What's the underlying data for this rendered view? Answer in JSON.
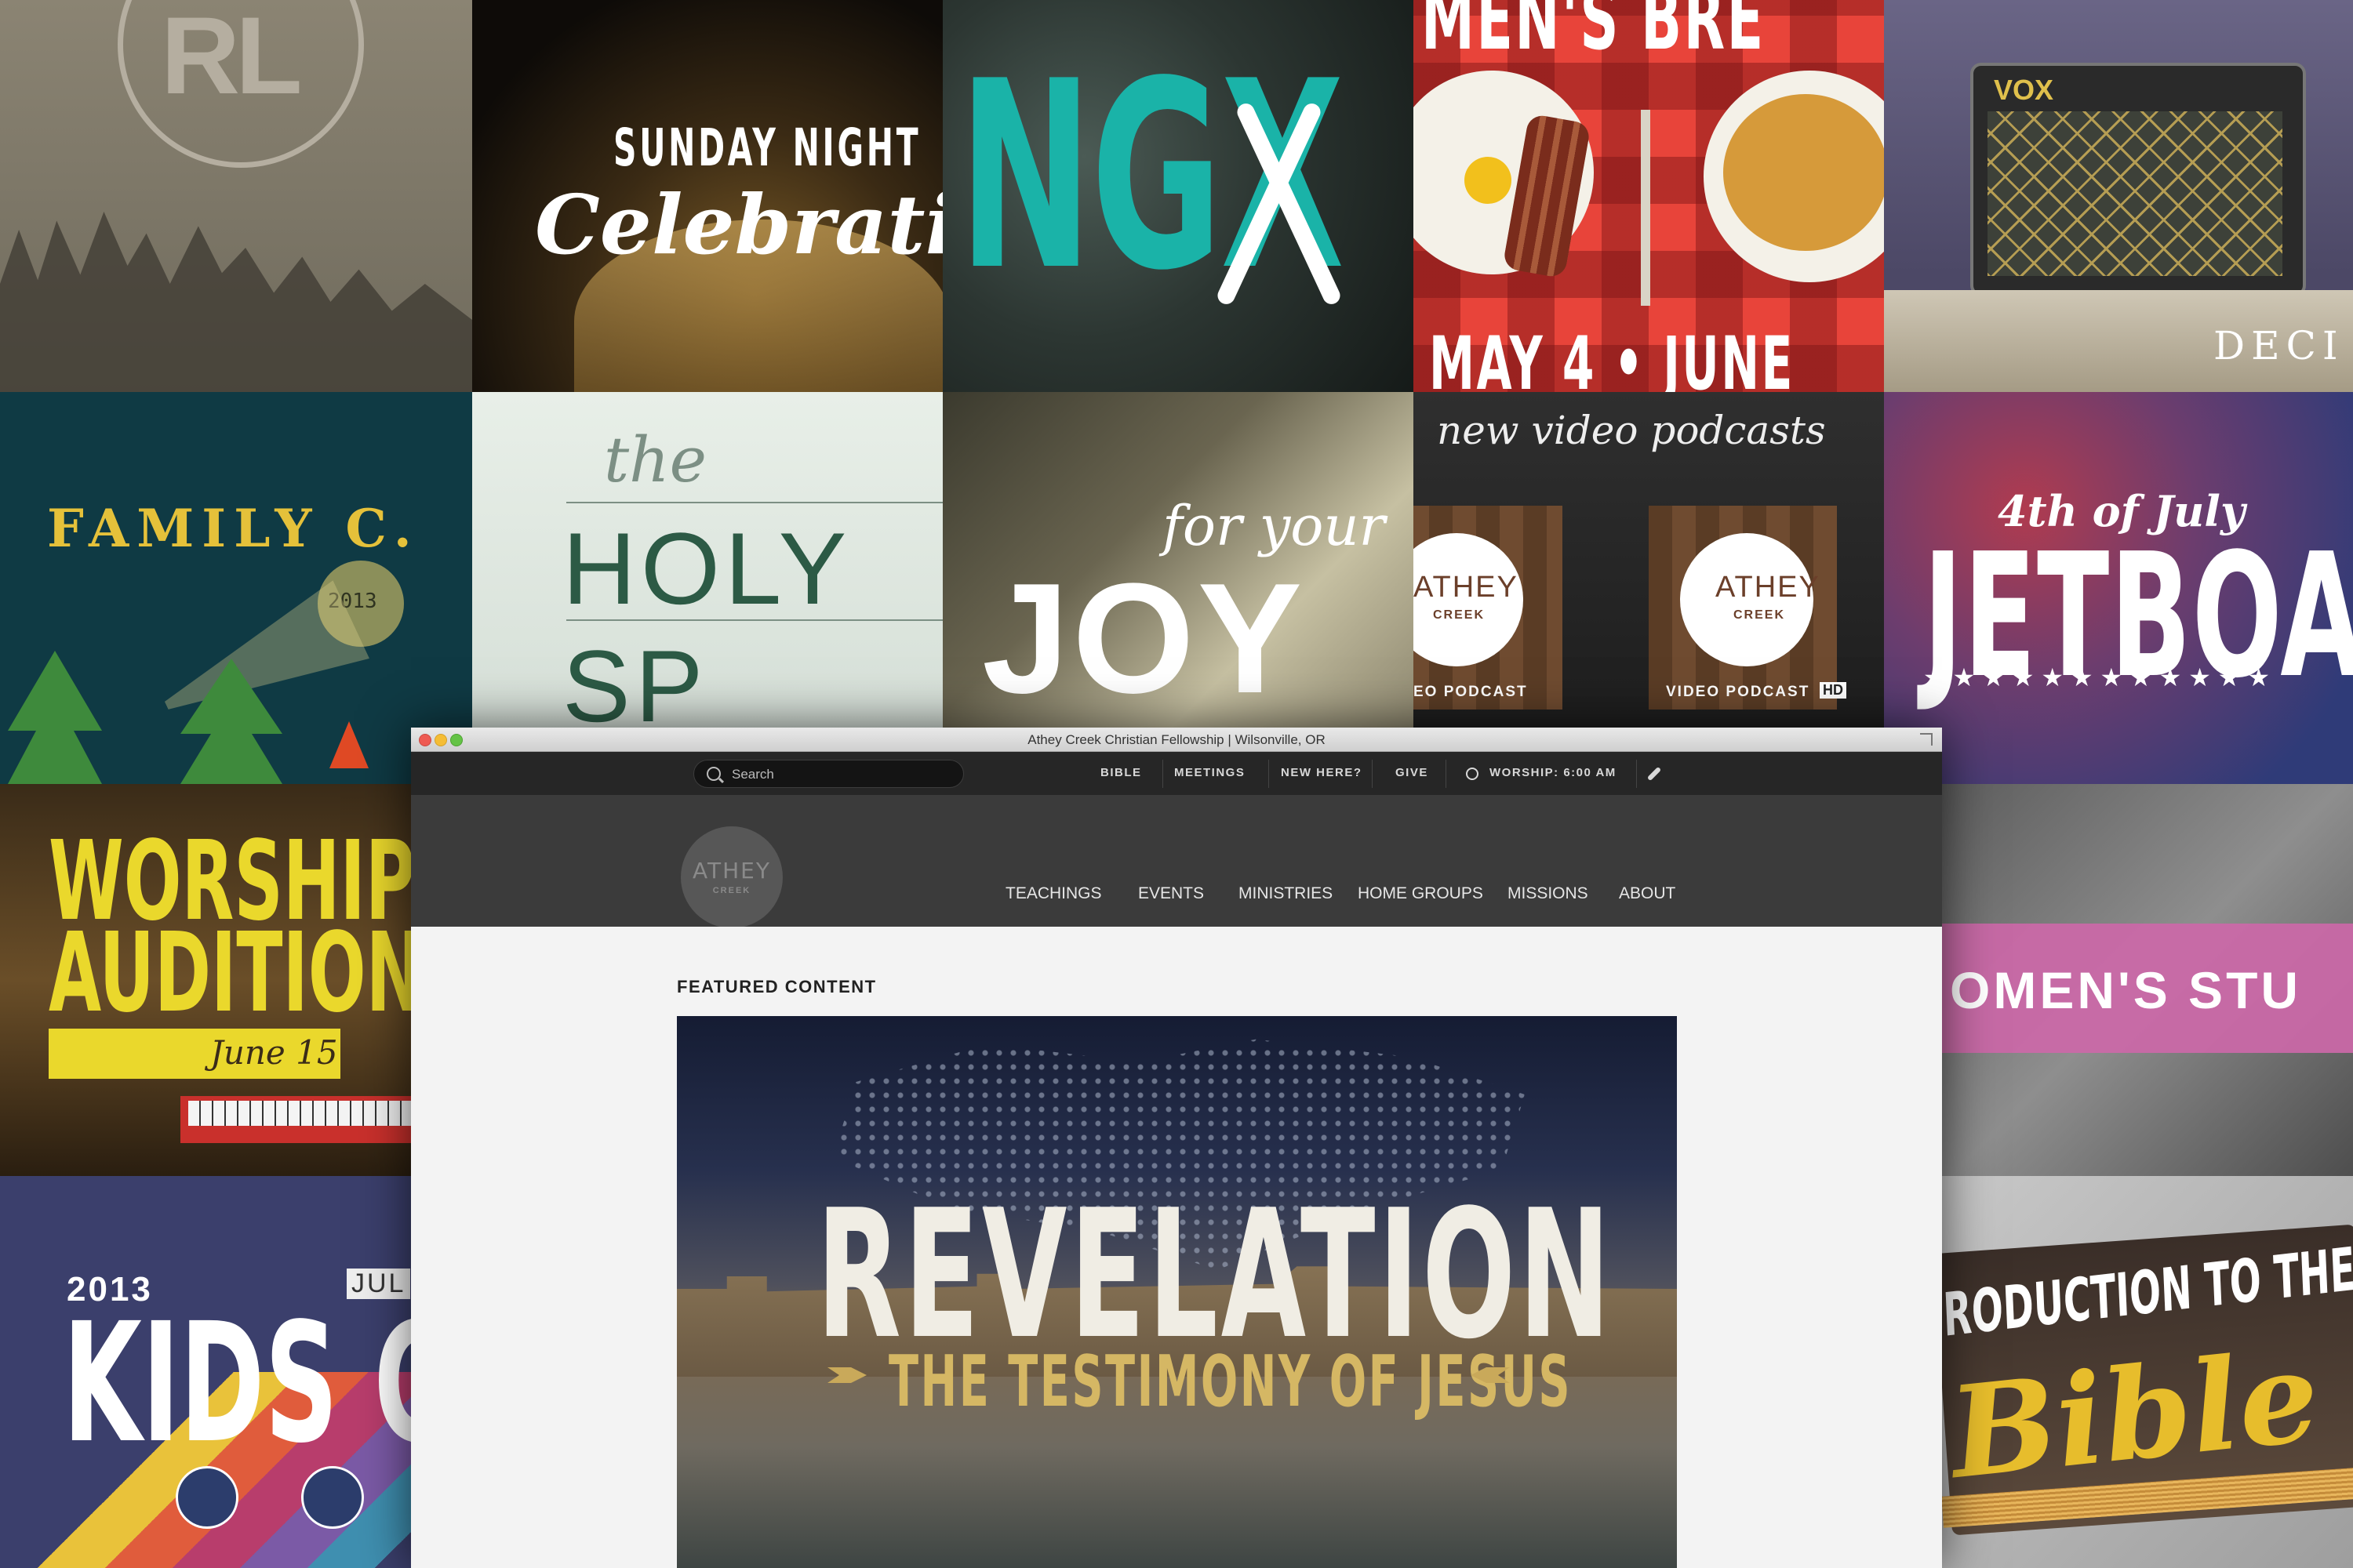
{
  "tiles": {
    "rl": "RL",
    "sunday_top": "SUNDAY NIGHT",
    "sunday_script": "Celebratio",
    "ngx": "NGX",
    "mens": "MEN'S BRE",
    "mens_date": "MAY 4 • JUNE",
    "vox": "VOX",
    "vox_dec": "DECI",
    "family": "FAMILY C.",
    "family_year": "2013",
    "holy_the": "the",
    "holy": "HOLY SP",
    "joy_script": "for your",
    "joy": "JOY",
    "podcast_title": "new video podcasts",
    "podcast_brand": "ATHEY",
    "podcast_sub": "CREEK",
    "podcast_label_left": "EO PODCAST",
    "podcast_label_right": "VIDEO PODCAST",
    "podcast_hd": "HD",
    "july_top": "4th of July",
    "july": "JETBOATS",
    "stars": "★ ★ ★ ★ ★ ★ ★ ★ ★ ★ ★ ★",
    "worship1": "WORSHIP",
    "worship2": "AUDITIONS",
    "worship_date": "June 15",
    "women": "OMEN'S STU",
    "kids_year": "2013",
    "kids_month": "JUL",
    "kids": "KIDS CA",
    "intro": "RODUCTION TO THE",
    "bible": "Bible"
  },
  "browser": {
    "title": "Athey Creek Christian Fellowship | Wilsonville, OR",
    "search_placeholder": "Search",
    "top_links": [
      "BIBLE",
      "MEETINGS",
      "NEW HERE?",
      "GIVE"
    ],
    "worship": "WORSHIP: 6:00 AM",
    "logo_name": "ATHEY",
    "logo_sub": "CREEK",
    "main_nav": [
      "TEACHINGS",
      "EVENTS",
      "MINISTRIES",
      "HOME GROUPS",
      "MISSIONS",
      "ABOUT"
    ],
    "featured_heading": "FEATURED CONTENT",
    "hero_title": "REVELATION",
    "hero_subtitle": "THE TESTIMONY OF JESUS"
  }
}
